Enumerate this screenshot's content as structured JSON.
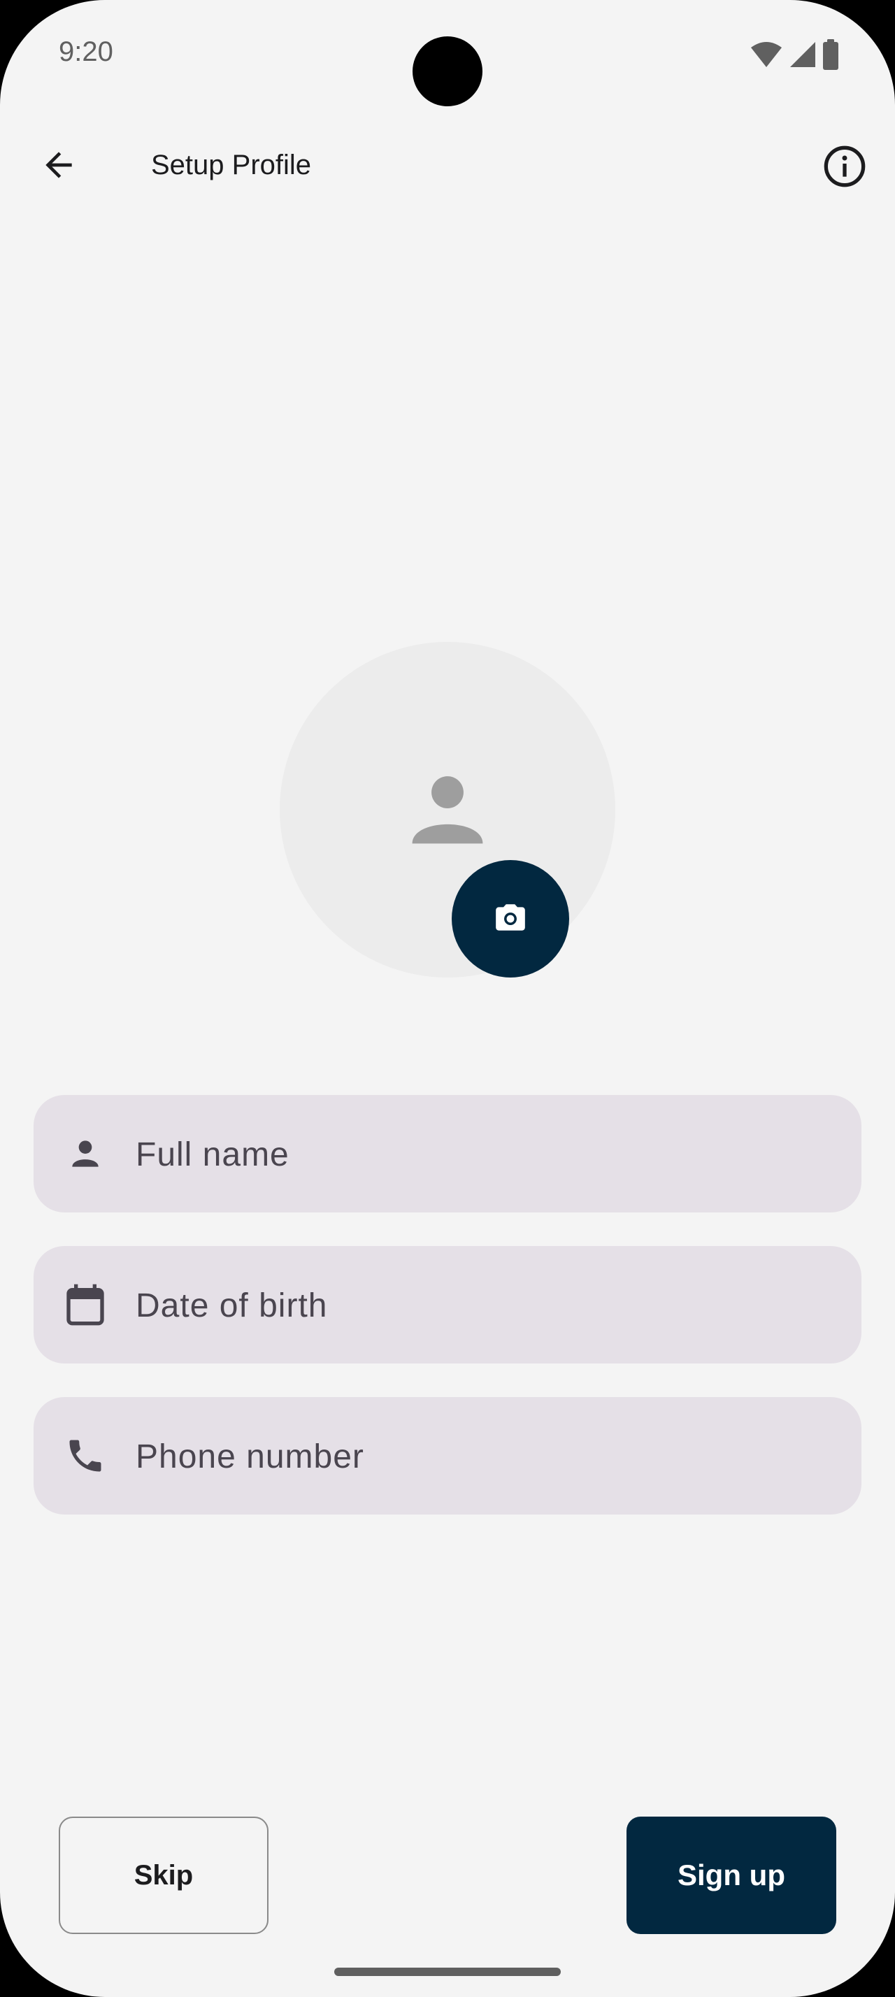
{
  "status_bar": {
    "time": "9:20",
    "icons": [
      "wifi-icon",
      "signal-icon",
      "battery-icon"
    ]
  },
  "app_bar": {
    "title": "Setup Profile",
    "back_icon": "arrow-back-icon",
    "info_icon": "info-icon"
  },
  "avatar": {
    "placeholder_icon": "person-icon",
    "camera_icon": "camera-icon"
  },
  "form": {
    "full_name": {
      "placeholder": "Full name",
      "value": "",
      "icon": "person-icon"
    },
    "date_of_birth": {
      "placeholder": "Date of birth",
      "value": "",
      "icon": "calendar-icon"
    },
    "phone_number": {
      "placeholder": "Phone number",
      "value": "",
      "icon": "phone-icon"
    }
  },
  "actions": {
    "skip_label": "Skip",
    "signup_label": "Sign up"
  },
  "colors": {
    "background": "#f4f4f4",
    "primary": "#022840",
    "field_bg": "#e5e0e7",
    "avatar_bg": "#ececec"
  }
}
